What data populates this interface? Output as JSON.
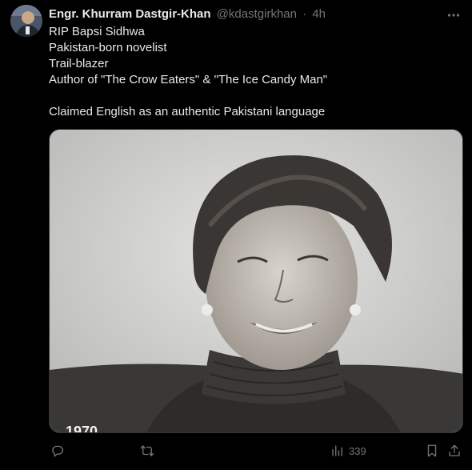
{
  "author": {
    "display_name": "Engr. Khurram Dastgir-Khan",
    "handle": "@kdastgirkhan",
    "separator": "·",
    "time": "4h"
  },
  "tweet": {
    "lines": [
      "RIP Bapsi Sidhwa",
      "Pakistan-born novelist",
      "Trail-blazer",
      "Author of \"The Crow Eaters\" & \"The Ice Candy Man\"",
      "",
      "Claimed English as an authentic Pakistani language"
    ]
  },
  "media": {
    "kind": "photo",
    "style": "black-and-white portrait",
    "corner_text": "1970"
  },
  "actions": {
    "reply_icon": "reply-icon",
    "retweet_icon": "retweet-icon",
    "views_icon": "views-icon",
    "views_count": "339",
    "bookmark_icon": "bookmark-icon",
    "share_icon": "share-icon"
  },
  "colors": {
    "background": "#000000",
    "primary_text": "#e7e9ea",
    "secondary_text": "#71767b",
    "border": "#2f3336"
  }
}
